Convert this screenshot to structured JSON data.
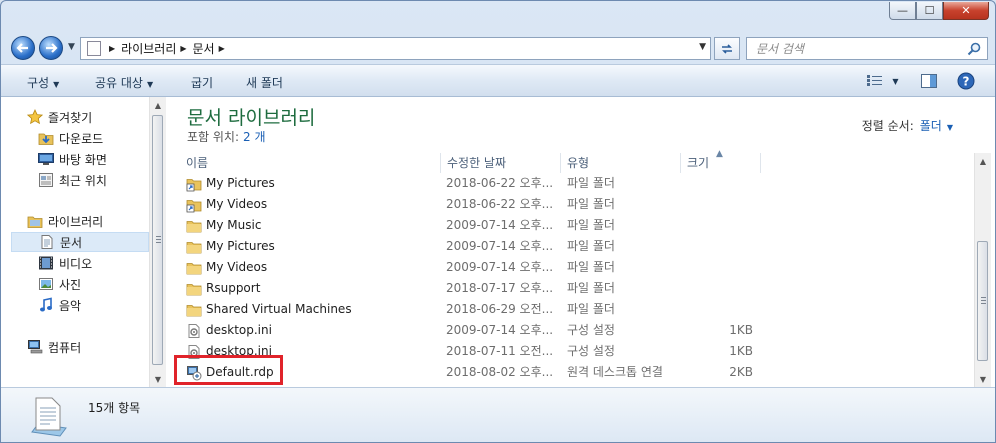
{
  "window": {
    "minimize_glyph": "—",
    "maximize_glyph": "☐",
    "close_glyph": "✕"
  },
  "address": {
    "crumbs": [
      "라이브러리",
      "문서"
    ],
    "search_placeholder": "문서 검색"
  },
  "toolbar": {
    "organize": "구성",
    "share": "공유 대상",
    "burn": "굽기",
    "new_folder": "새 폴더"
  },
  "nav": {
    "favorites": "즐겨찾기",
    "downloads": "다운로드",
    "desktop": "바탕 화면",
    "recent": "최근 위치",
    "libraries": "라이브러리",
    "documents": "문서",
    "videos": "비디오",
    "pictures": "사진",
    "music": "음악",
    "computer": "컴퓨터"
  },
  "library": {
    "title": "문서 라이브러리",
    "includes_label": "포함 위치:",
    "includes_link": "2 개",
    "sort_label": "정렬 순서:",
    "sort_value": "폴더"
  },
  "columns": {
    "name": "이름",
    "date": "수정한 날짜",
    "type": "유형",
    "size": "크기"
  },
  "files": [
    {
      "name": "My Pictures",
      "date": "2018-06-22 오후...",
      "type": "파일 폴더",
      "size": "",
      "icon": "shortcut-folder-icon"
    },
    {
      "name": "My Videos",
      "date": "2018-06-22 오후...",
      "type": "파일 폴더",
      "size": "",
      "icon": "shortcut-folder-icon"
    },
    {
      "name": "My Music",
      "date": "2009-07-14 오후...",
      "type": "파일 폴더",
      "size": "",
      "icon": "folder-icon"
    },
    {
      "name": "My Pictures",
      "date": "2009-07-14 오후...",
      "type": "파일 폴더",
      "size": "",
      "icon": "folder-icon"
    },
    {
      "name": "My Videos",
      "date": "2009-07-14 오후...",
      "type": "파일 폴더",
      "size": "",
      "icon": "folder-icon"
    },
    {
      "name": "Rsupport",
      "date": "2018-07-17 오후...",
      "type": "파일 폴더",
      "size": "",
      "icon": "folder-icon"
    },
    {
      "name": "Shared Virtual Machines",
      "date": "2018-06-29 오전...",
      "type": "파일 폴더",
      "size": "",
      "icon": "folder-icon"
    },
    {
      "name": "desktop.ini",
      "date": "2009-07-14 오후...",
      "type": "구성 설정",
      "size": "1KB",
      "icon": "settings-file-icon"
    },
    {
      "name": "desktop.ini",
      "date": "2018-07-11 오전...",
      "type": "구성 설정",
      "size": "1KB",
      "icon": "settings-file-icon"
    },
    {
      "name": "Default.rdp",
      "date": "2018-08-02 오후...",
      "type": "원격 데스크톱 연결",
      "size": "2KB",
      "icon": "rdp-file-icon"
    }
  ],
  "details": {
    "count": "15개 항목"
  }
}
